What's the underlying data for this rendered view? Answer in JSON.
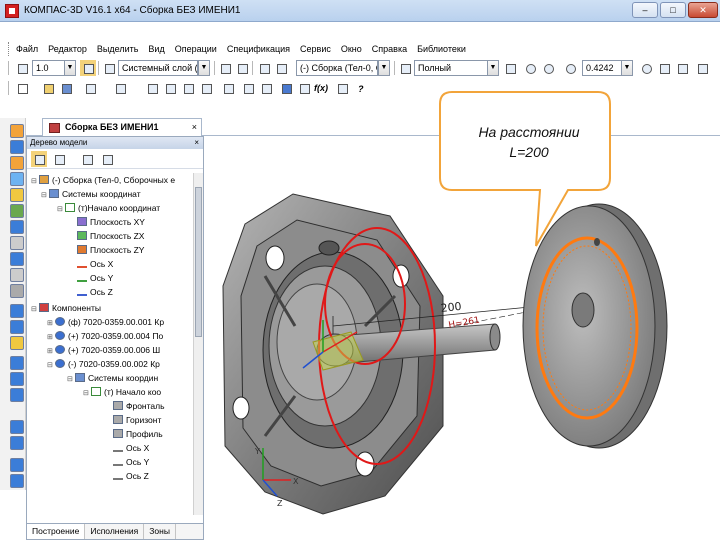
{
  "window": {
    "title": "КОМПАС-3D V16.1 x64 - Сборка БЕЗ ИМЕНИ1",
    "min": "–",
    "max": "□",
    "close": "✕"
  },
  "menu": [
    "Файл",
    "Редактор",
    "Выделить",
    "Вид",
    "Операции",
    "Спецификация",
    "Сервис",
    "Окно",
    "Справка",
    "Библиотеки"
  ],
  "toolbar1": {
    "line_width": "1.0",
    "layer": "Системный слой (0)",
    "context": "(-) Сборка (Тел-0, С",
    "display_mode": "Полный",
    "zoom": "0.4242"
  },
  "toolbar2": {
    "fx_label": "f(x)"
  },
  "document_tab": {
    "label": "Сборка БЕЗ ИМЕНИ1",
    "close": "×"
  },
  "tree": {
    "header": "Дерево модели",
    "close": "×",
    "nodes": [
      "(-) Сборка (Тел-0, Сборочных е",
      "Системы координат",
      "(т)Начало координат",
      "Плоскость XY",
      "Плоскость ZX",
      "Плоскость ZY",
      "Ось X",
      "Ось Y",
      "Ось Z",
      "Компоненты",
      "(ф) 7020-0359.00.001 Кр",
      "(+) 7020-0359.00.004 По",
      "(+) 7020-0359.00.006 Ш",
      "(-) 7020-0359.00.002 Кр",
      "Системы координ",
      "(т) Начало коо",
      "Фронталь",
      "Горизонт",
      "Профиль",
      "Ось X",
      "Ось Y",
      "Ось Z"
    ],
    "bottom_tabs": [
      "Построение",
      "Исполнения",
      "Зоны"
    ]
  },
  "viewport": {
    "dimension": "200",
    "dimension_second": "H=261",
    "axis_x": "X",
    "axis_y": "Y",
    "axis_z": "Z"
  },
  "callout": {
    "line1": "На расстоянии",
    "line2": "L=200"
  }
}
